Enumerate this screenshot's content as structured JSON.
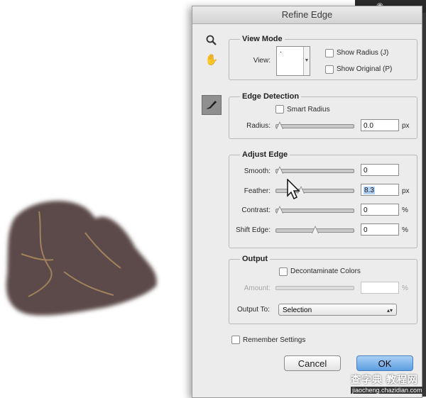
{
  "window_title": "Refine Edge",
  "view_mode": {
    "legend": "View Mode",
    "view_label": "View:",
    "show_radius": "Show Radius (J)",
    "show_original": "Show Original (P)"
  },
  "edge_detection": {
    "legend": "Edge Detection",
    "smart_radius": "Smart Radius",
    "radius_label": "Radius:",
    "radius_value": "0.0",
    "radius_unit": "px"
  },
  "adjust_edge": {
    "legend": "Adjust Edge",
    "smooth_label": "Smooth:",
    "smooth_value": "0",
    "feather_label": "Feather:",
    "feather_value": "8.3",
    "feather_unit": "px",
    "contrast_label": "Contrast:",
    "contrast_value": "0",
    "contrast_unit": "%",
    "shift_label": "Shift Edge:",
    "shift_value": "0",
    "shift_unit": "%"
  },
  "output": {
    "legend": "Output",
    "decontaminate": "Decontaminate Colors",
    "amount_label": "Amount:",
    "amount_unit": "%",
    "output_to_label": "Output To:",
    "output_to_value": "Selection"
  },
  "remember_settings": "Remember Settings",
  "buttons": {
    "cancel": "Cancel",
    "ok": "OK"
  },
  "watermark": {
    "line1": "查字典 教程网",
    "line2": "jiaocheng.chazidian.com"
  },
  "sliders": {
    "radius": 0,
    "smooth": 0,
    "feather": 0.3,
    "contrast": 0,
    "shift_edge": 0.5,
    "amount": 0
  },
  "icons": {
    "zoom": "magnifier-icon",
    "hand": "hand-icon",
    "brush": "refine-radius-brush-icon",
    "cursor": "arrow-cursor-icon"
  }
}
